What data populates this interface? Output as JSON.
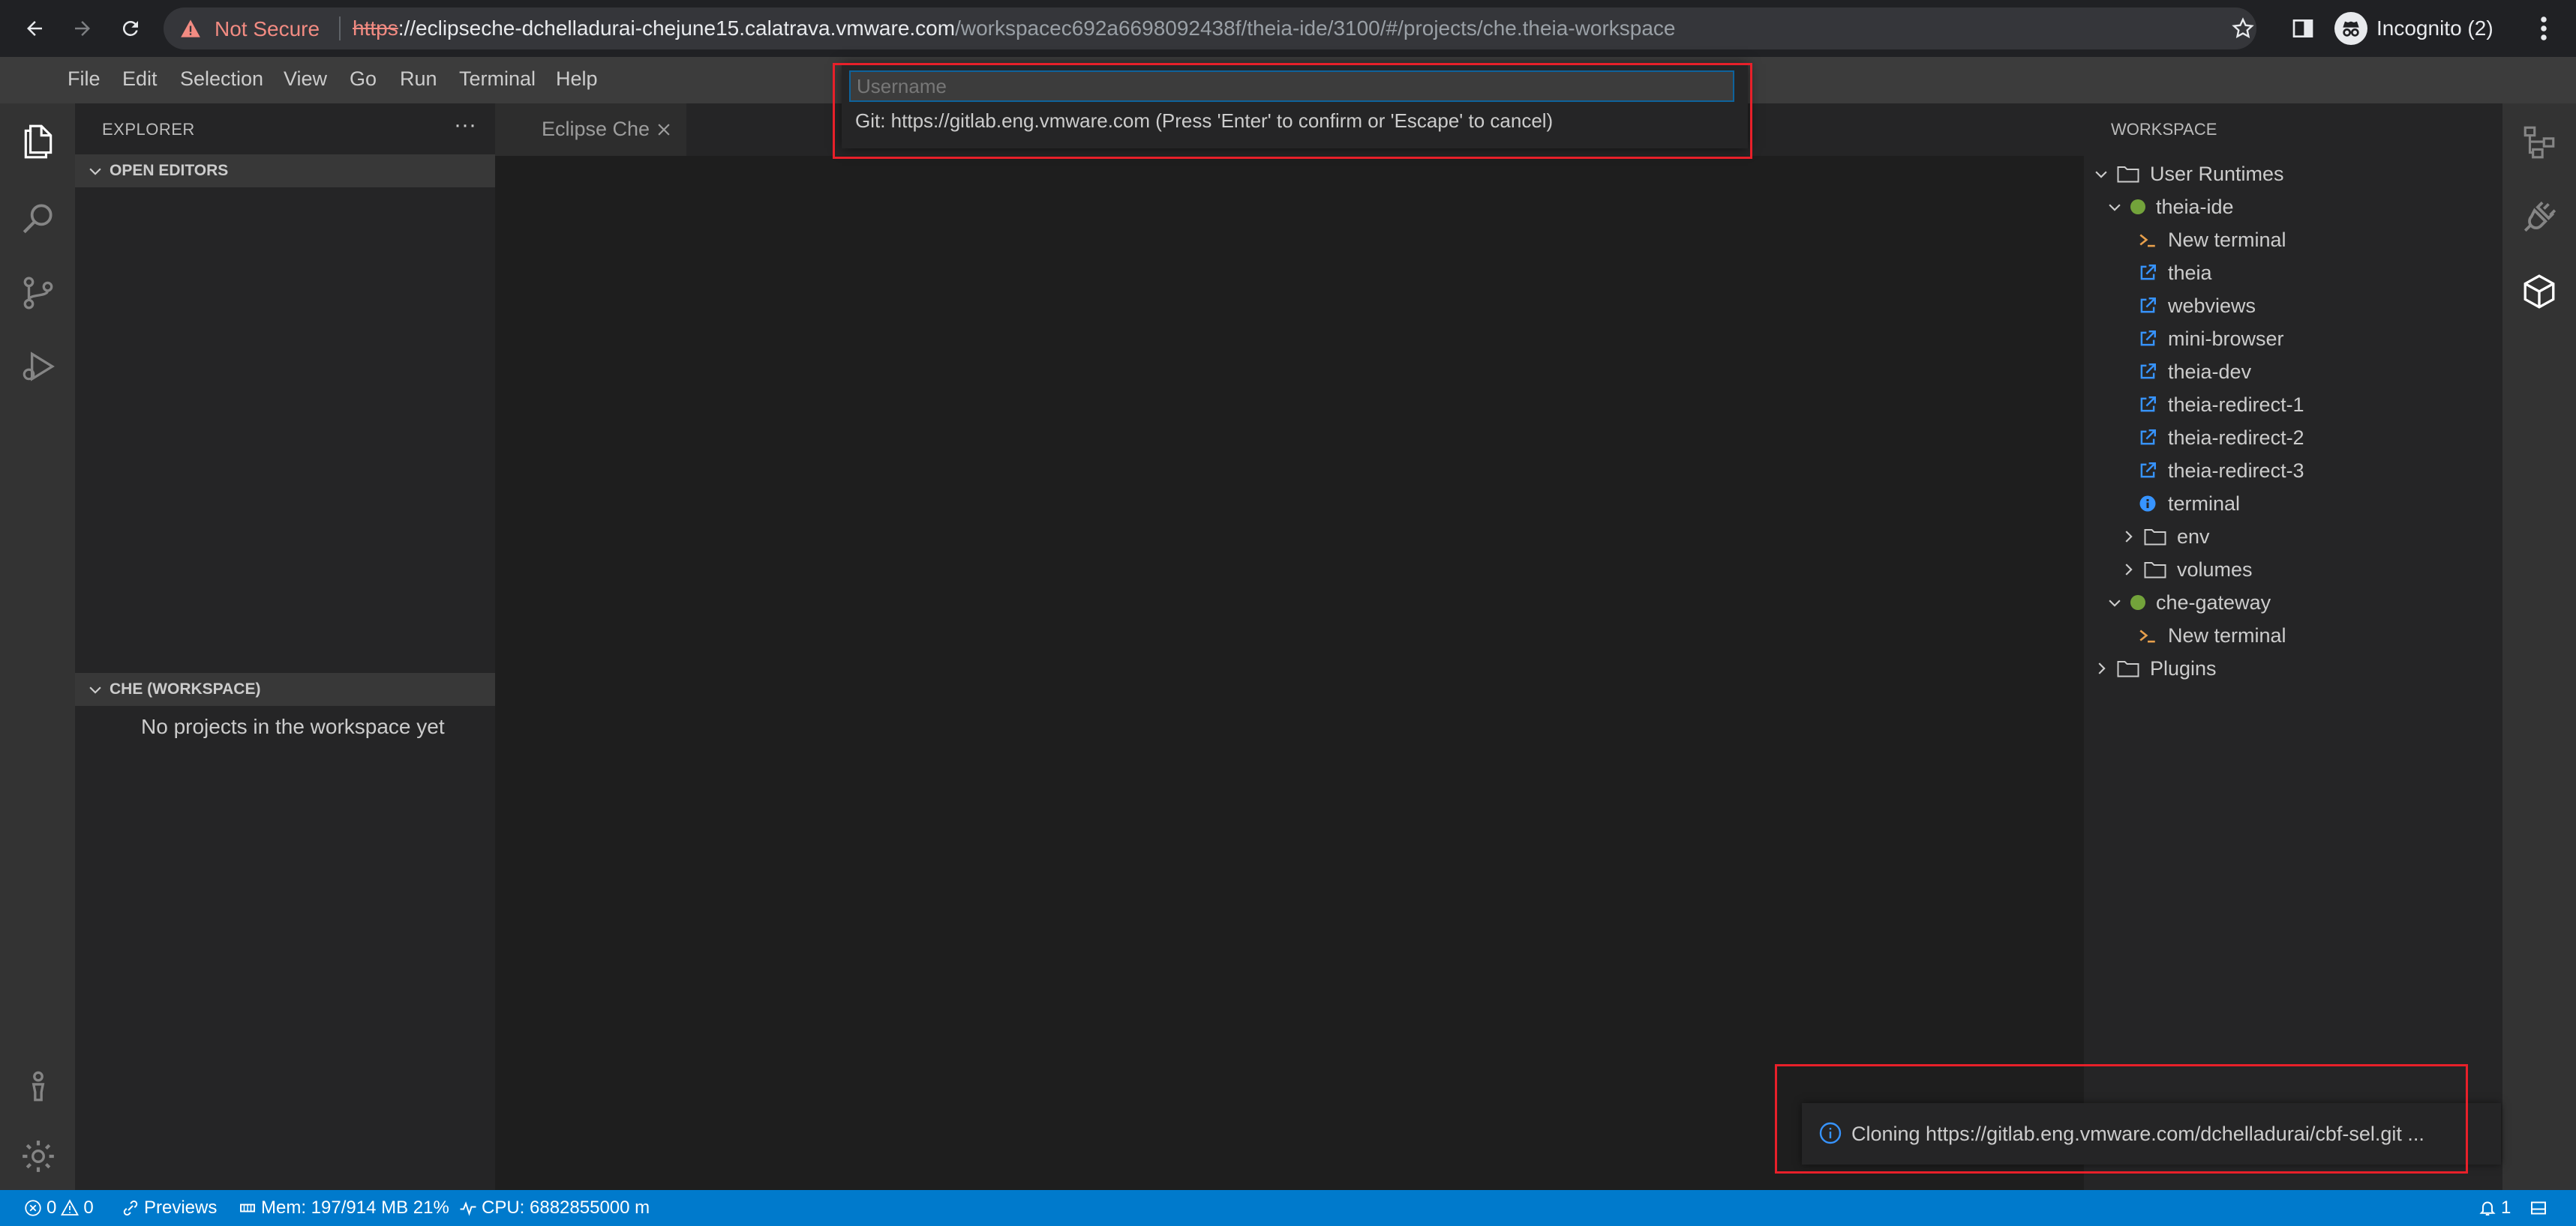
{
  "browser": {
    "security_label": "Not Secure",
    "url_scheme": "https",
    "url_host": "://eclipseche-dchelladurai-chejune15.calatrava.vmware.com",
    "url_path": "/workspacec692a6698092438f/theia-ide/3100/#/projects/che.theia-workspace",
    "profile_label": "Incognito (2)"
  },
  "menu": {
    "file": "File",
    "edit": "Edit",
    "selection": "Selection",
    "view": "View",
    "go": "Go",
    "run": "Run",
    "terminal": "Terminal",
    "help": "Help"
  },
  "explorer": {
    "title": "EXPLORER",
    "more": "···",
    "open_editors": "OPEN EDITORS",
    "che_workspace": "CHE (WORKSPACE)",
    "empty_message": "No projects in the workspace yet"
  },
  "tab": {
    "label": "Eclipse Che"
  },
  "quick_input": {
    "placeholder": "Username",
    "message": "Git: https://gitlab.eng.vmware.com (Press 'Enter' to confirm or 'Escape' to cancel)"
  },
  "workspace": {
    "title": "WORKSPACE",
    "tree": {
      "user_runtimes": "User Runtimes",
      "theia_ide": "theia-ide",
      "theia_new_terminal": "New terminal",
      "theia": "theia",
      "webviews": "webviews",
      "mini_browser": "mini-browser",
      "theia_dev": "theia-dev",
      "redirect_1": "theia-redirect-1",
      "redirect_2": "theia-redirect-2",
      "redirect_3": "theia-redirect-3",
      "terminal": "terminal",
      "env": "env",
      "volumes": "volumes",
      "che_gateway": "che-gateway",
      "gateway_new_terminal": "New terminal",
      "plugins": "Plugins"
    }
  },
  "notification": {
    "message": "Cloning https://gitlab.eng.vmware.com/dchelladurai/cbf-sel.git ..."
  },
  "status": {
    "errors": "0",
    "warnings": "0",
    "previews": "Previews",
    "memory": "Mem: 197/914 MB 21%",
    "cpu": "CPU: 6882855000 m",
    "notifications_count": "1"
  },
  "colors": {
    "status_bar": "#007acc",
    "running_dot": "#73a33b",
    "highlight_outline": "#e8202a",
    "terminal_icon": "#e8a04c",
    "link_icon": "#3794ff"
  }
}
